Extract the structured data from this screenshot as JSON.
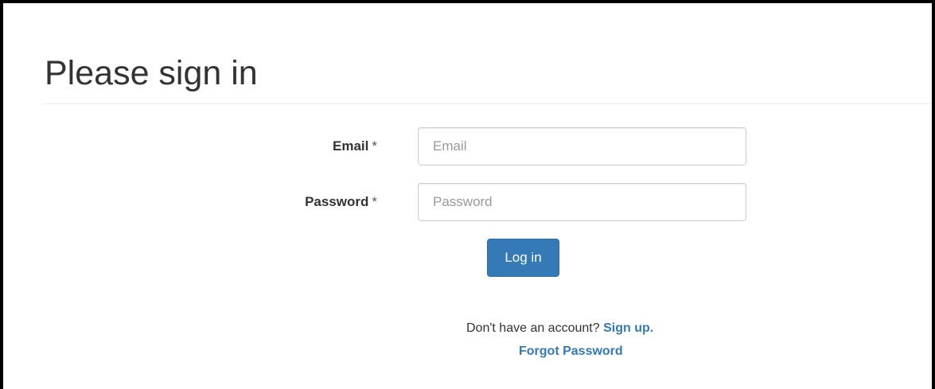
{
  "header": {
    "title": "Please sign in"
  },
  "form": {
    "email": {
      "label": "Email",
      "required_mark": "*",
      "placeholder": "Email",
      "value": ""
    },
    "password": {
      "label": "Password",
      "required_mark": "*",
      "placeholder": "Password",
      "value": ""
    },
    "submit_label": "Log in"
  },
  "footer": {
    "prompt": "Don't have an account?",
    "signup_link": "Sign up.",
    "forgot_link": "Forgot Password"
  },
  "colors": {
    "primary": "#337ab7",
    "text": "#333333",
    "border": "#cccccc",
    "frame": "#000000"
  }
}
